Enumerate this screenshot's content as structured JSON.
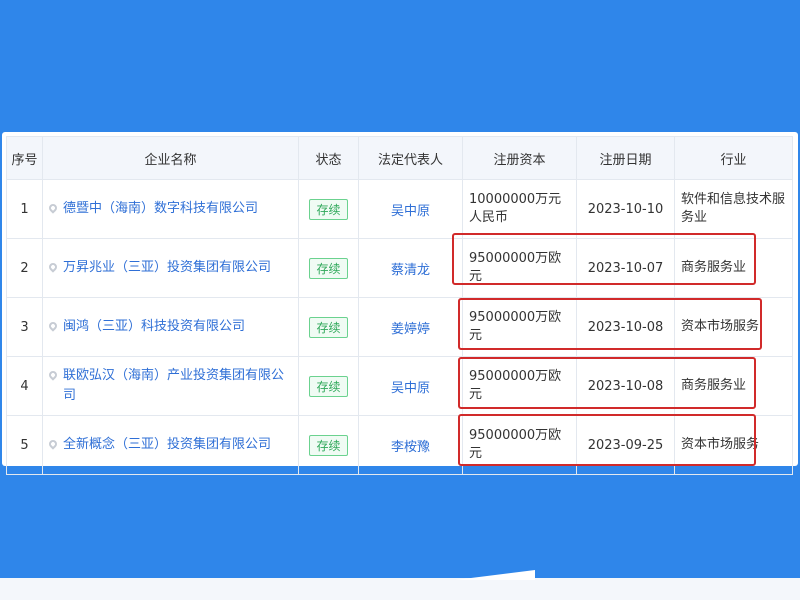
{
  "table": {
    "headers": [
      "序号",
      "企业名称",
      "状态",
      "法定代表人",
      "注册资本",
      "注册日期",
      "行业"
    ],
    "rows": [
      {
        "no": "1",
        "name": "德暨中（海南）数字科技有限公司",
        "status": "存续",
        "rep": "吴中原",
        "capital": "10000000万元人民币",
        "date": "2023-10-10",
        "industry": "软件和信息技术服务业"
      },
      {
        "no": "2",
        "name": "万昇兆业（三亚）投资集团有限公司",
        "status": "存续",
        "rep": "蔡清龙",
        "capital": "95000000万欧元",
        "date": "2023-10-07",
        "industry": "商务服务业"
      },
      {
        "no": "3",
        "name": "闽鸿（三亚）科技投资有限公司",
        "status": "存续",
        "rep": "姜婷婷",
        "capital": "95000000万欧元",
        "date": "2023-10-08",
        "industry": "资本市场服务"
      },
      {
        "no": "4",
        "name": "联欧弘汉（海南）产业投资集团有限公司",
        "status": "存续",
        "rep": "吴中原",
        "capital": "95000000万欧元",
        "date": "2023-10-08",
        "industry": "商务服务业"
      },
      {
        "no": "5",
        "name": "全新概念（三亚）投资集团有限公司",
        "status": "存续",
        "rep": "李桉豫",
        "capital": "95000000万欧元",
        "date": "2023-09-25",
        "industry": "资本市场服务"
      }
    ]
  },
  "colors": {
    "background": "#2f86ea",
    "link": "#2f6fd6",
    "status_green": "#2fa85a",
    "highlight_red": "#d12a2a"
  }
}
